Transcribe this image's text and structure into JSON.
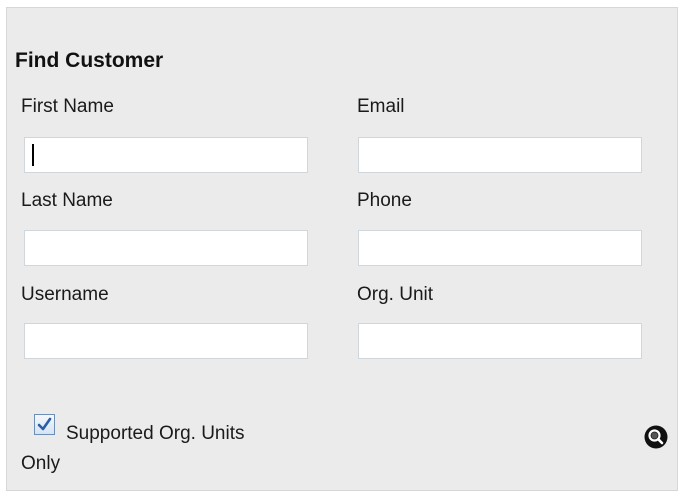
{
  "form": {
    "title": "Find Customer",
    "fields": {
      "first_name": {
        "label": "First Name",
        "value": ""
      },
      "email": {
        "label": "Email",
        "value": ""
      },
      "last_name": {
        "label": "Last Name",
        "value": ""
      },
      "phone": {
        "label": "Phone",
        "value": ""
      },
      "username": {
        "label": "Username",
        "value": ""
      },
      "org_unit": {
        "label": "Org. Unit",
        "value": ""
      }
    },
    "supported_org_units": {
      "label_line1": "Supported Org. Units",
      "label_line2": "Only",
      "checked": true
    },
    "search_icon": "magnifier-icon"
  },
  "colors": {
    "panel_bg": "#ebebeb",
    "input_border": "#cfd6dc",
    "checkbox_check": "#2a5ea8"
  }
}
